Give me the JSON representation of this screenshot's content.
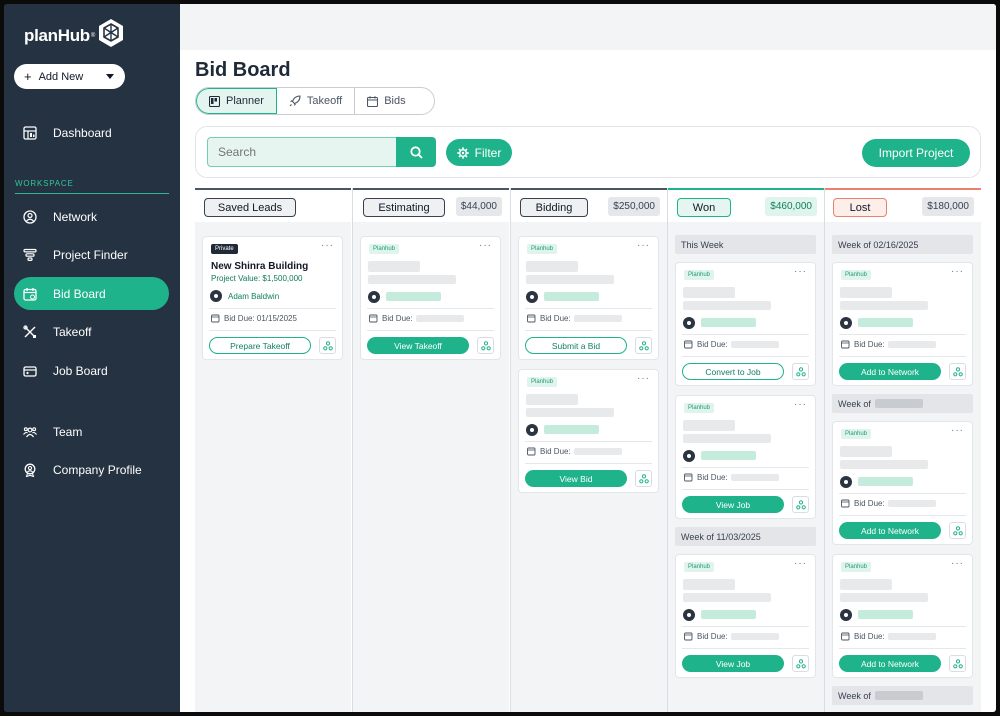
{
  "brand": {
    "name": "planHub",
    "reg": "®"
  },
  "sidebar": {
    "add_new": "Add New",
    "workspace_label": "WORKSPACE",
    "items": [
      {
        "label": "Dashboard",
        "icon": "dashboard-icon"
      },
      {
        "label": "Network",
        "icon": "user-circle-icon"
      },
      {
        "label": "Project Finder",
        "icon": "funnel-icon"
      },
      {
        "label": "Bid Board",
        "icon": "calendar-icon",
        "active": true
      },
      {
        "label": "Takeoff",
        "icon": "tools-icon"
      },
      {
        "label": "Job Board",
        "icon": "wallet-icon"
      },
      {
        "label": "Team",
        "icon": "team-icon"
      },
      {
        "label": "Company Profile",
        "icon": "badge-icon"
      }
    ]
  },
  "header": {
    "title": "Bid Board",
    "tabs": [
      {
        "label": "Planner",
        "icon": "planner-icon",
        "active": true
      },
      {
        "label": "Takeoff",
        "icon": "rocket-icon"
      },
      {
        "label": "Bids",
        "icon": "calendar-icon"
      }
    ]
  },
  "toolbar": {
    "search_placeholder": "Search",
    "filter_label": "Filter",
    "import_label": "Import Project"
  },
  "colors": {
    "accent": "#1fb38b",
    "sidebar_bg": "#253241",
    "won_accent": "#1fb38b",
    "lost_accent": "#e8826f"
  },
  "columns": [
    {
      "status": "Saved Leads",
      "amount": "",
      "cards": [
        {
          "tag": "Private",
          "title": "New Shinra Building",
          "value": "Project Value: $1,500,000",
          "person": "Adam Baldwin",
          "bid_due": "Bid Due: 01/15/2025",
          "action": "Prepare Takeoff"
        }
      ]
    },
    {
      "status": "Estimating",
      "amount": "$44,000",
      "cards": [
        {
          "tag": "Planhub",
          "bid_due": "Bid Due:",
          "action": "View Takeoff"
        }
      ]
    },
    {
      "status": "Bidding",
      "amount": "$250,000",
      "cards": [
        {
          "tag": "Planhub",
          "bid_due": "Bid Due:",
          "action": "Submit a Bid"
        },
        {
          "tag": "Planhub",
          "bid_due": "Bid Due:",
          "action": "View Bid"
        }
      ]
    },
    {
      "status": "Won",
      "amount": "$460,000",
      "groups": [
        "This Week",
        "Week of 11/03/2025"
      ],
      "cards": [
        {
          "tag": "Planhub",
          "bid_due": "Bid Due:",
          "action": "Convert to Job"
        },
        {
          "tag": "Planhub",
          "bid_due": "Bid Due:",
          "action": "View Job"
        },
        {
          "tag": "Planhub",
          "bid_due": "Bid Due:",
          "action": "View Job"
        }
      ]
    },
    {
      "status": "Lost",
      "amount": "$180,000",
      "groups": [
        "Week of 02/16/2025",
        "Week of",
        "Week of"
      ],
      "cards": [
        {
          "tag": "Planhub",
          "bid_due": "Bid Due:",
          "action": "Add to Network"
        },
        {
          "tag": "Planhub",
          "bid_due": "Bid Due:",
          "action": "Add to Network"
        },
        {
          "tag": "Planhub",
          "bid_due": "Bid Due:",
          "action": "Add to Network"
        }
      ]
    }
  ]
}
